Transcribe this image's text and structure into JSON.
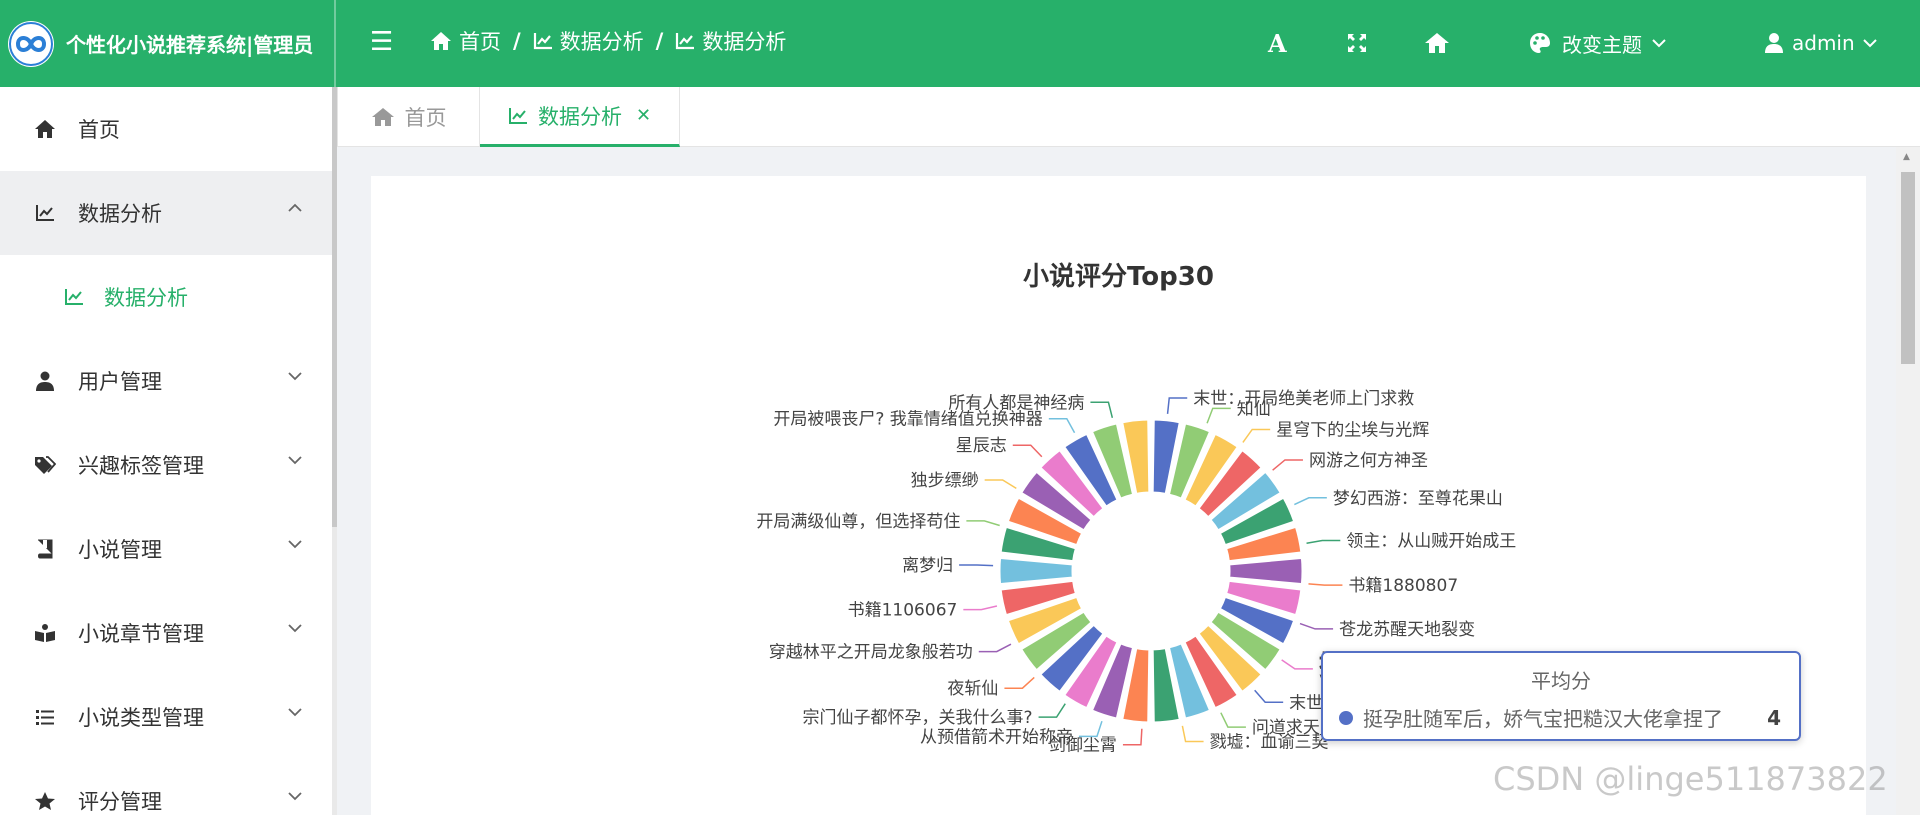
{
  "header": {
    "brand_title": "个性化小说推荐系统|管理员",
    "breadcrumbs": [
      "首页",
      "数据分析",
      "数据分析"
    ],
    "theme_label": "改变主题",
    "user_label": "admin",
    "accent_color": "#27b06a"
  },
  "sidebar": {
    "items": [
      {
        "label": "首页",
        "icon": "home-icon"
      },
      {
        "label": "数据分析",
        "icon": "chart-line-icon",
        "open": true
      },
      {
        "label": "数据分析",
        "icon": "chart-line-icon",
        "sub": true
      },
      {
        "label": "用户管理",
        "icon": "user-icon"
      },
      {
        "label": "兴趣标签管理",
        "icon": "tags-icon"
      },
      {
        "label": "小说管理",
        "icon": "book-icon"
      },
      {
        "label": "小说章节管理",
        "icon": "book-open-icon"
      },
      {
        "label": "小说类型管理",
        "icon": "list-icon"
      },
      {
        "label": "评分管理",
        "icon": "star-icon"
      }
    ]
  },
  "tabs": [
    {
      "label": "首页",
      "active": false
    },
    {
      "label": "数据分析",
      "active": true
    }
  ],
  "chart_data": {
    "type": "pie",
    "title": "小说评分Top30",
    "series_name": "平均分",
    "categories": [
      "末世：开局绝美老师上门求救",
      "知仙",
      "星穹下的尘埃与光辉",
      "网游之何方神圣",
      "梦幻西游：至尊花果山",
      "领主：从山贼开始成王",
      "书籍1880807",
      "苍龙苏醒天地裂变",
      "挺孕肚随军后，娇气宝把糙汉大佬拿捏了",
      "末世锦鲤：全局农田养成记",
      "问道求天",
      "戮墟：血谕三契",
      "剑御尘霄",
      "从预借箭术开始称帝",
      "宗门仙子都怀孕，关我什么事?",
      "夜斩仙",
      "穿越林平之开局龙象般若功",
      "书籍1106067",
      "离梦归",
      "开局满级仙尊，但选择苟住",
      "独步缥缈",
      "星辰志",
      "开局被喂丧尸? 我靠情绪值兑换神器",
      "所有人都是神经病"
    ],
    "labels_visible": [
      "末世：开局绝美老师上门求救",
      "知仙",
      "星穹下的尘埃与光辉",
      "网游之何方神圣",
      "梦幻西游：至尊花果山",
      "领主：从山贼开始成王",
      "书籍1880807",
      "苍龙苏醒天地裂变",
      "挺孕肚随军后，娇气宝把糙汉大佬",
      "末世锦鲤：全局农田养成记",
      "问道求天",
      "戮墟：血谕三契",
      "剑御尘霄",
      "从预借箭术开始称帝",
      "宗门仙子都怀孕，关我什么事?",
      "夜斩仙",
      "穿越林平之开局龙象般若功",
      "书籍1106067",
      "离梦归",
      "开局满级仙尊，但选择苟住",
      "独步缥缈",
      "星辰志",
      "开局被喂丧尸? 我靠情绪值兑换神器",
      "所有人都是神经病"
    ],
    "values": [
      4,
      4,
      4,
      4,
      4,
      4,
      4,
      4,
      4,
      4,
      4,
      4,
      4,
      4,
      4,
      4,
      4,
      4,
      4,
      4,
      4,
      4,
      4,
      4,
      4,
      4,
      4,
      4,
      4,
      4
    ],
    "colors": [
      "#5470c6",
      "#91cc75",
      "#fac858",
      "#ee6666",
      "#73c0de",
      "#3ba272",
      "#fc8452",
      "#9a60b4",
      "#ea7ccc"
    ],
    "legend": "none"
  },
  "tooltip": {
    "title": "平均分",
    "name": "挺孕肚随军后，娇气宝把糙汉大佬拿捏了",
    "value": "4"
  },
  "watermark": "CSDN @linge511873822"
}
